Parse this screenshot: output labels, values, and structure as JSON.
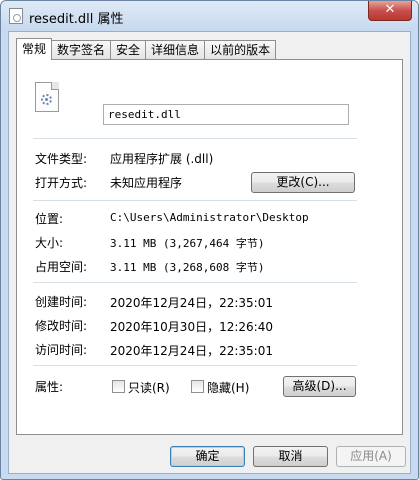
{
  "window": {
    "title": "resedit.dll 属性",
    "close_glyph": "✕"
  },
  "tabs": [
    "常规",
    "数字签名",
    "安全",
    "详细信息",
    "以前的版本"
  ],
  "general": {
    "file_name": "resedit.dll",
    "file_type_label": "文件类型:",
    "file_type_value": "应用程序扩展 (.dll)",
    "open_with_label": "打开方式:",
    "open_with_value": "未知应用程序",
    "change_button": "更改(C)...",
    "location_label": "位置:",
    "location_value": "C:\\Users\\Administrator\\Desktop",
    "size_label": "大小:",
    "size_value": "3.11 MB (3,267,464 字节)",
    "size_on_disk_label": "占用空间:",
    "size_on_disk_value": "3.11 MB (3,268,608 字节)",
    "created_label": "创建时间:",
    "created_value": "2020年12月24日，22:35:01",
    "modified_label": "修改时间:",
    "modified_value": "2020年10月30日，12:26:40",
    "accessed_label": "访问时间:",
    "accessed_value": "2020年12月24日，22:35:01",
    "attributes_label": "属性:",
    "readonly_label": "只读(R)",
    "hidden_label": "隐藏(H)",
    "advanced_button": "高级(D)..."
  },
  "footer": {
    "ok": "确定",
    "cancel": "取消",
    "apply": "应用(A)"
  },
  "icons": {
    "title_icon": "dll-file-icon",
    "file_icon": "dll-gear-file-icon"
  },
  "colors": {
    "frame": "#c7daf0",
    "close_button": "#c75050",
    "panel": "#ffffff",
    "separator": "#d5dfe5"
  }
}
